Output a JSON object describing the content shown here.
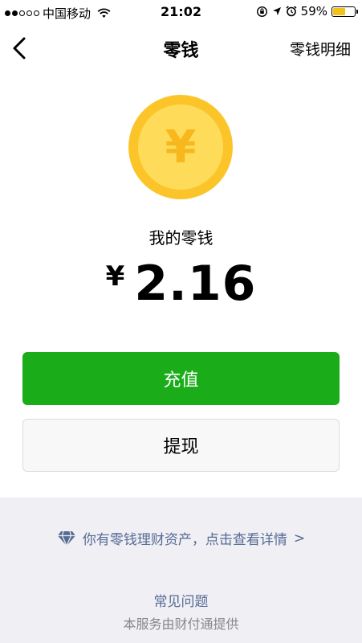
{
  "status_bar": {
    "carrier": "中国移动",
    "time": "21:02",
    "battery_percent_text": "59%",
    "battery_level": 0.59,
    "signal_bars_filled": 2,
    "signal_bars_total": 5,
    "icons": [
      "wifi-icon",
      "rotation-lock-icon",
      "location-arrow-icon",
      "alarm-icon",
      "battery-icon"
    ]
  },
  "nav": {
    "title": "零钱",
    "right_action": "零钱明细",
    "back_icon": "chevron-left-icon"
  },
  "coin": {
    "symbol": "¥",
    "colors": {
      "outer": "#fbc52a",
      "inner": "#ffdb5a",
      "symbol": "#f6b81c"
    }
  },
  "balance": {
    "label": "我的零钱",
    "currency": "¥",
    "amount": "2.16"
  },
  "buttons": {
    "recharge": "充值",
    "withdraw": "提现"
  },
  "footer": {
    "wealth_text": "你有零钱理财资产，点击查看详情",
    "wealth_chevron": ">",
    "faq": "常见问题",
    "provider": "本服务由财付通提供"
  },
  "colors": {
    "primary_green": "#1aad19",
    "link_blue": "#576b95",
    "footer_bg": "#efeff4",
    "battery": "#f2c21b"
  }
}
